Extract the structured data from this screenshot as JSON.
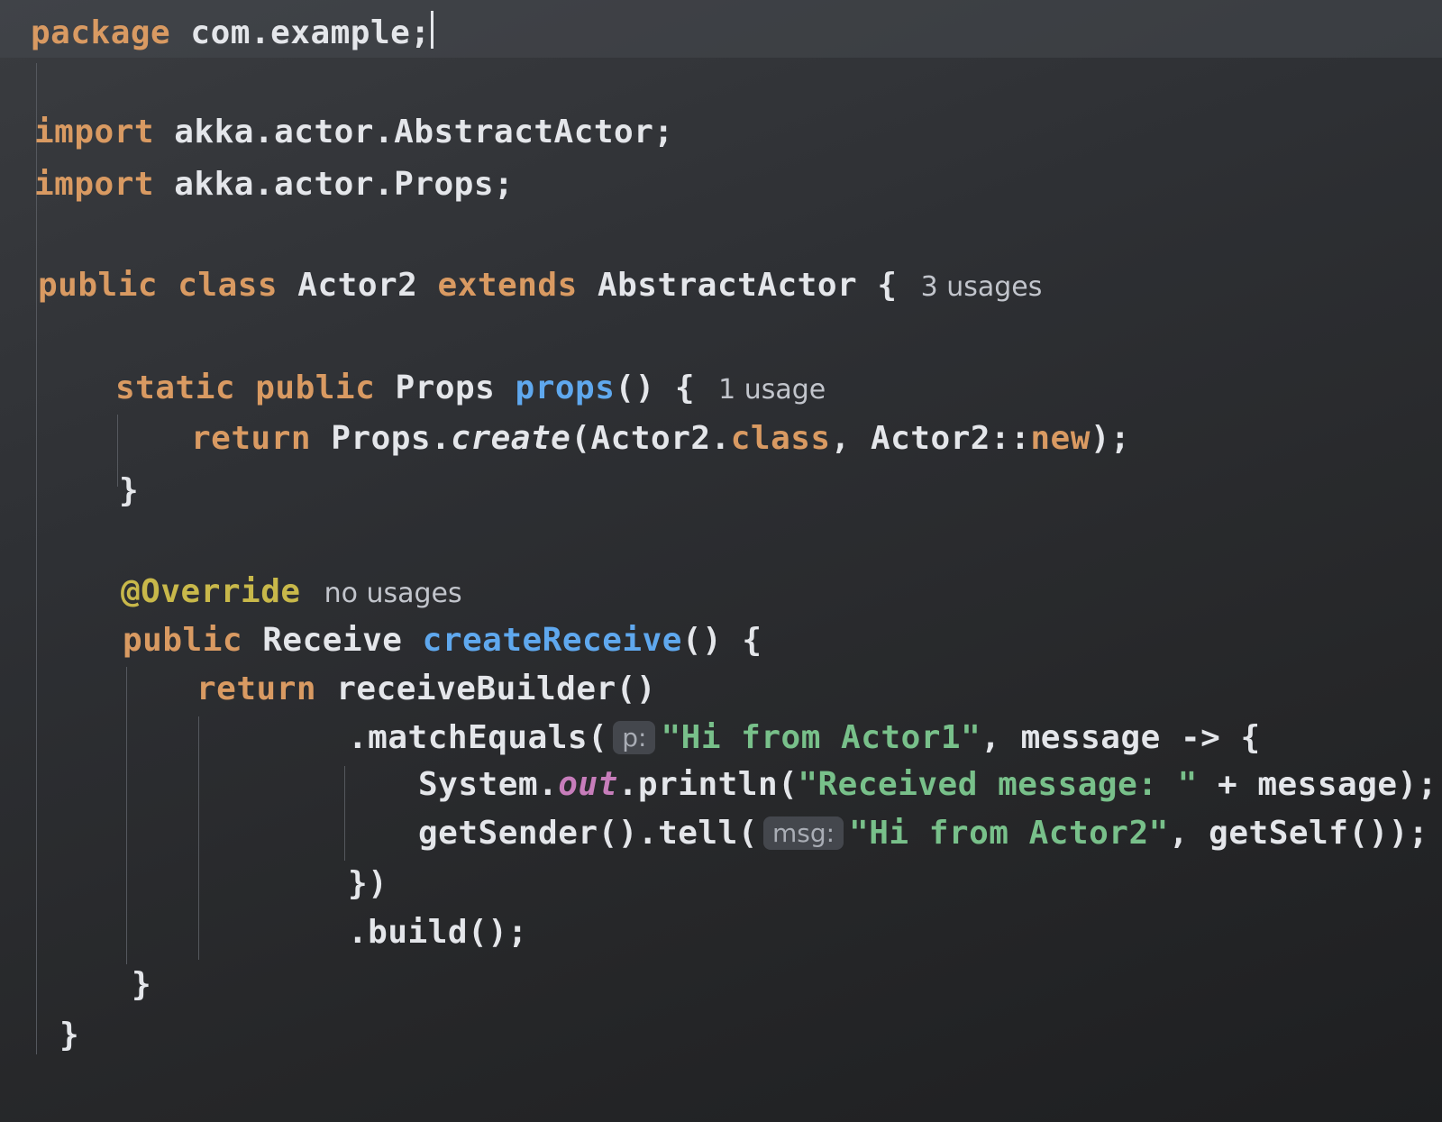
{
  "code": {
    "package_kw": "package",
    "package_name": "com.example;",
    "import_kw": "import",
    "import1": "akka.actor.AbstractActor;",
    "import2": "akka.actor.Props;",
    "public_kw": "public",
    "class_kw": "class",
    "class_name": "Actor2",
    "extends_kw": "extends",
    "super_class": "AbstractActor",
    "open_brace": "{",
    "close_brace": "}",
    "class_usages": "3 usages",
    "static_kw": "static",
    "props_type": "Props",
    "props_method": "props",
    "props_sig_end": "() {",
    "props_usages": "1 usage",
    "return_kw": "return",
    "props_create": "Props.",
    "create_fn": "create",
    "create_args1": "(Actor2.",
    "class_lit": "class",
    "create_args2": ", Actor2::",
    "new_kw": "new",
    "create_end": ");",
    "override_ann": "@Override",
    "override_usages": "no usages",
    "receive_type": "Receive",
    "create_receive": "createReceive",
    "sig_end": "() {",
    "receive_builder": "receiveBuilder()",
    "match_equals": ".matchEquals(",
    "param_p": "p:",
    "str_hi1": "\"Hi from Actor1\"",
    "lambda": ", message -> {",
    "system": "System.",
    "out_field": "out",
    "println": ".println(",
    "str_received": "\"Received message: \"",
    "concat": " + message);",
    "tell": "getSender().tell(",
    "param_msg": "msg:",
    "str_hi2": "\"Hi from Actor2\"",
    "tell_end": ", getSelf());",
    "lambda_close": "})",
    "build": ".build();"
  }
}
